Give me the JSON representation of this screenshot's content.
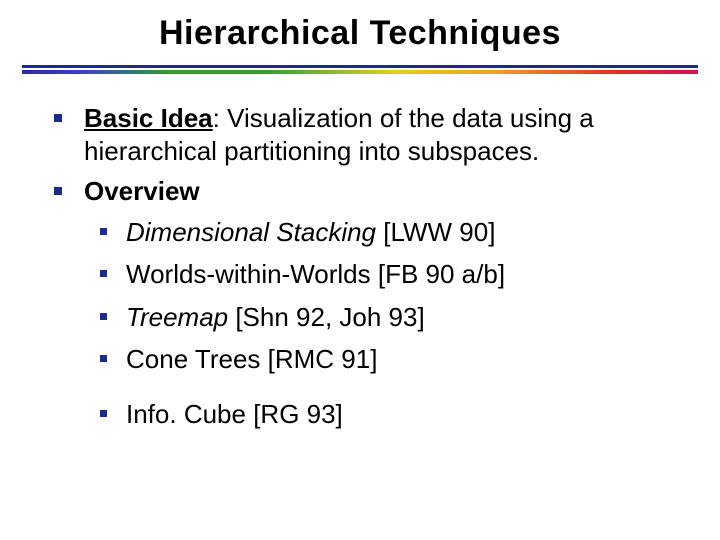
{
  "title": "Hierarchical Techniques",
  "bullets": [
    {
      "runs": [
        {
          "text": "Basic Idea",
          "bold": true,
          "underline": true
        },
        {
          "text": ":  Visualization of the data using a hierarchical partitioning into subspaces."
        }
      ]
    },
    {
      "runs": [
        {
          "text": "Overview",
          "bold": true
        }
      ],
      "sub": [
        {
          "runs": [
            {
              "text": "Dimensional Stacking",
              "italic": true
            },
            {
              "text": " [LWW 90]"
            }
          ]
        },
        {
          "runs": [
            {
              "text": "Worlds-within-Worlds [FB 90 a/b]"
            }
          ]
        },
        {
          "runs": [
            {
              "text": "Treemap",
              "italic": true
            },
            {
              "text": " [Shn 92, Joh 93]"
            }
          ]
        },
        {
          "runs": [
            {
              "text": "Cone Trees [RMC 91]"
            }
          ]
        },
        {
          "gap": true
        },
        {
          "runs": [
            {
              "text": "Info. Cube [RG 93]"
            }
          ]
        }
      ]
    }
  ]
}
